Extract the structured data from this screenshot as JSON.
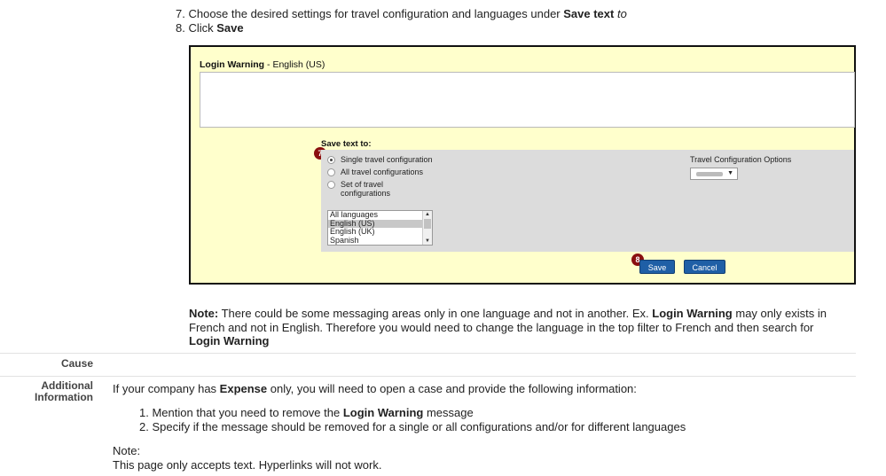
{
  "steps": [
    {
      "num": "7.",
      "text": "Choose the desired settings for travel configuration and languages under ",
      "bold": "Save text",
      "italic": " to"
    },
    {
      "num": "8.",
      "text": "Click ",
      "bold": "Save"
    }
  ],
  "screenshot": {
    "title_bold": "Login Warning",
    "title_rest": " - English (US)",
    "save_text_label": "Save text to:",
    "radios": [
      {
        "label": "Single travel configuration",
        "selected": true
      },
      {
        "label": "All travel configurations",
        "selected": false
      },
      {
        "label": "Set of travel configurations",
        "selected": false
      }
    ],
    "languages": [
      "All languages",
      "English (US)",
      "English (UK)",
      "Spanish"
    ],
    "selected_language": "English (US)",
    "tco_label": "Travel Configuration Options",
    "marker_7": "7",
    "marker_8": "8",
    "save_button": "Save",
    "cancel_button": "Cancel",
    "marker_color": "#8a0f0f",
    "button_color": "#1f5fa6",
    "panel_bg": "#ffffcc"
  },
  "note": {
    "label": "Note:",
    "text1": " There could be some messaging areas only in one language and not in another. Ex. ",
    "bold1": "Login Warning",
    "text2": " may only exists in French and not in English. Therefore you would need to change the language in the top filter to French and then search for ",
    "bold2": "Login Warning"
  },
  "rows": {
    "cause_label": "Cause",
    "additional_label_1": "Additional",
    "additional_label_2": "Information"
  },
  "additional": {
    "text1": "If your company has ",
    "bold": "Expense",
    "text2": " only, you will need to open a case and provide the following information:",
    "items": [
      {
        "num": "1.",
        "text1": "Mention that you need to remove the ",
        "bold": "Login Warning",
        "text2": " message"
      },
      {
        "num": "2.",
        "text1": "Specify if the message should be removed for a single or all configurations and/or for different languages",
        "bold": "",
        "text2": ""
      }
    ],
    "note_label": "Note:",
    "note_text": "This page only accepts text. Hyperlinks will not work."
  }
}
